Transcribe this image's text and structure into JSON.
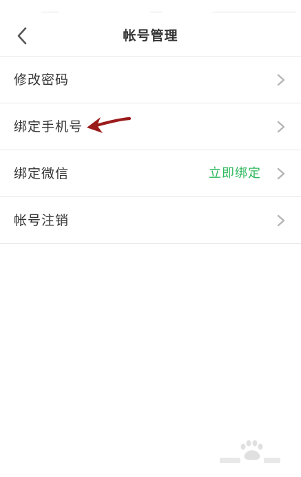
{
  "header": {
    "title": "帐号管理"
  },
  "rows": [
    {
      "label": "修改密码",
      "value": ""
    },
    {
      "label": "绑定手机号",
      "value": ""
    },
    {
      "label": "绑定微信",
      "value": "立即绑定"
    },
    {
      "label": "帐号注销",
      "value": ""
    }
  ],
  "colors": {
    "accent_green": "#2eb85c",
    "annotation_red": "#9b1b1b",
    "divider": "#e6e6e6"
  },
  "icons": {
    "back": "chevron-left-icon",
    "row_arrow": "chevron-right-icon",
    "annotation": "arrow-icon",
    "watermark": "baidu-paw-icon"
  }
}
